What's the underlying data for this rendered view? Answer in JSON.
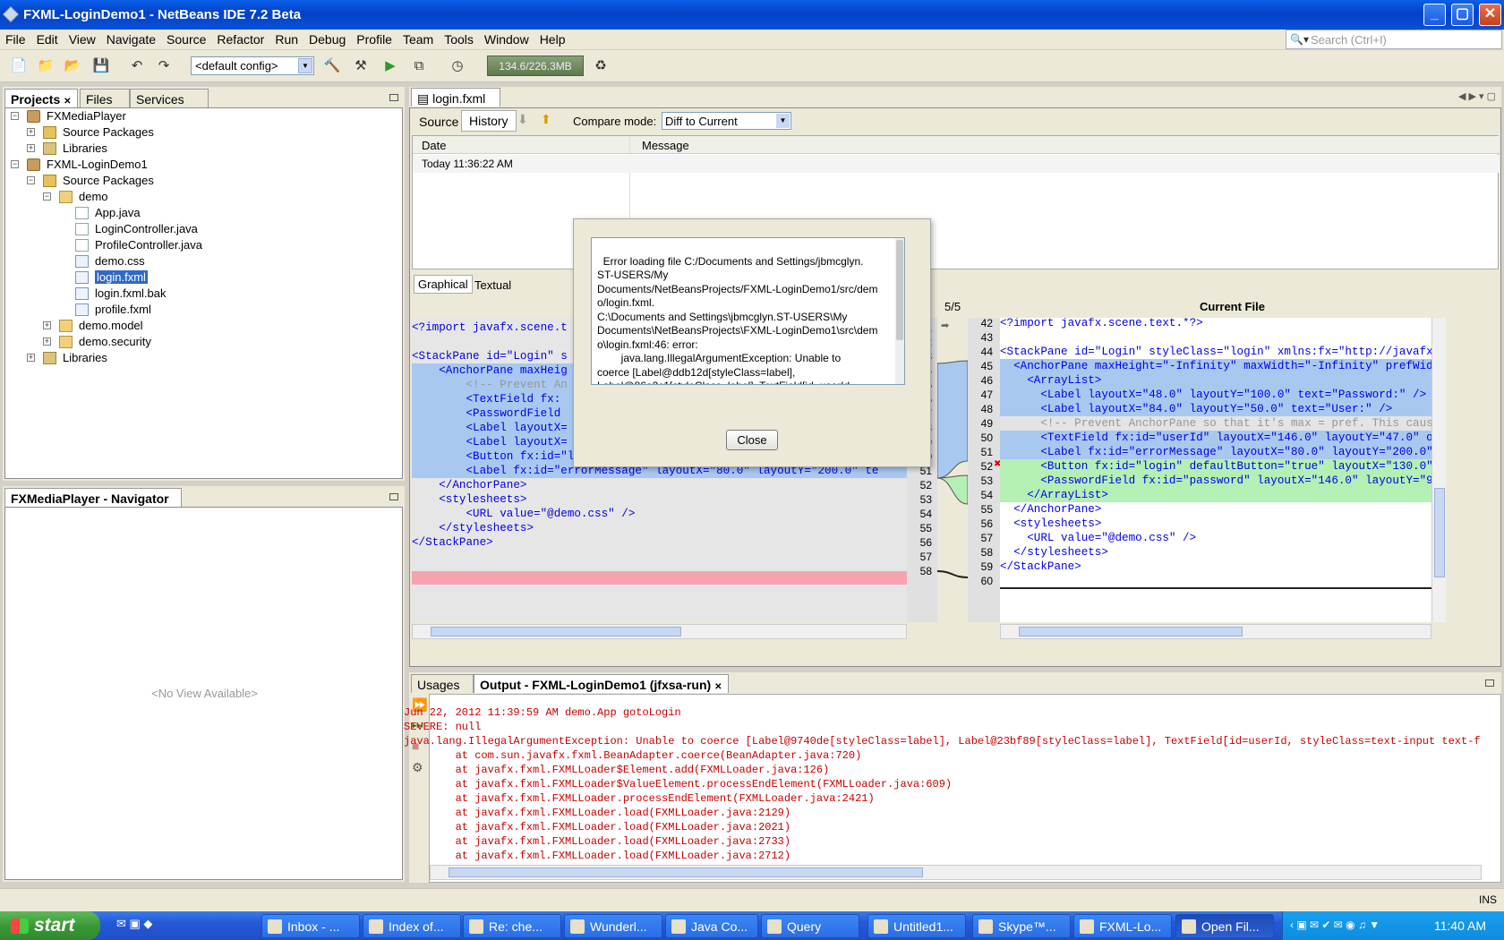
{
  "window": {
    "title": "FXML-LoginDemo1 - NetBeans IDE 7.2 Beta"
  },
  "menu": [
    "File",
    "Edit",
    "View",
    "Navigate",
    "Source",
    "Refactor",
    "Run",
    "Debug",
    "Profile",
    "Team",
    "Tools",
    "Window",
    "Help"
  ],
  "search": {
    "placeholder": "Search (Ctrl+I)"
  },
  "toolbar": {
    "config": "<default config>",
    "memory": "134.6/226.3MB"
  },
  "projects_panel": {
    "tabs": [
      "Projects",
      "Files",
      "Services"
    ],
    "tree": [
      {
        "label": "FXMediaPlayer"
      },
      {
        "label": "Source Packages"
      },
      {
        "label": "Libraries"
      },
      {
        "label": "FXML-LoginDemo1"
      },
      {
        "label": "Source Packages"
      },
      {
        "label": "demo"
      },
      {
        "label": "App.java"
      },
      {
        "label": "LoginController.java"
      },
      {
        "label": "ProfileController.java"
      },
      {
        "label": "demo.css"
      },
      {
        "label": "login.fxml"
      },
      {
        "label": "login.fxml.bak"
      },
      {
        "label": "profile.fxml"
      },
      {
        "label": "demo.model"
      },
      {
        "label": "demo.security"
      },
      {
        "label": "Libraries"
      }
    ]
  },
  "navigator": {
    "title": "FXMediaPlayer - Navigator",
    "empty": "<No View Available>"
  },
  "editor": {
    "tab": "login.fxml",
    "subtabs": [
      "Source",
      "History"
    ],
    "compare_label": "Compare mode:",
    "compare_value": "Diff to Current",
    "history_headers": [
      "Date",
      "Message"
    ],
    "history_row": "Today 11:36:22 AM",
    "diff_tabs": [
      "Graphical",
      "Textual"
    ],
    "diff_count": "5/5",
    "right_title": "Current File"
  },
  "left_code": [
    "<?import javafx.scene.t",
    "",
    "<StackPane id=\"Login\" s",
    "    <AnchorPane maxHeig",
    "        <!-- Prevent An",
    "        <TextField fx:",
    "        <PasswordField",
    "        <Label layoutX=",
    "        <Label layoutX=",
    "        <Button fx:id=\"login\" defaultButton=\"true\" layoutX=\"200.0\" la",
    "        <Label fx:id=\"errorMessage\" layoutX=\"80.0\" layoutY=\"200.0\" te",
    "    </AnchorPane>",
    "    <stylesheets>",
    "        <URL value=\"@demo.css\" />",
    "    </stylesheets>",
    "</StackPane>",
    ""
  ],
  "left_nums": [
    "1",
    "2",
    "3",
    "4",
    "5",
    "6",
    "7",
    "8",
    "9",
    "50",
    "51",
    "52",
    "53",
    "54",
    "55",
    "56",
    "57",
    "58"
  ],
  "right_code": [
    "<?import javafx.scene.text.*?>",
    "",
    "<StackPane id=\"Login\" styleClass=\"login\" xmlns:fx=\"http://javafx.",
    "  <AnchorPane maxHeight=\"-Infinity\" maxWidth=\"-Infinity\" prefWidt",
    "    <ArrayList>",
    "      <Label layoutX=\"48.0\" layoutY=\"100.0\" text=\"Password:\" />",
    "      <Label layoutX=\"84.0\" layoutY=\"50.0\" text=\"User:\" />",
    "      <!-- Prevent AnchorPane so that it's max = pref. This cause",
    "      <TextField fx:id=\"userId\" layoutX=\"146.0\" layoutY=\"47.0\" or",
    "      <Label fx:id=\"errorMessage\" layoutX=\"80.0\" layoutY=\"200.0\"",
    "      <Button fx:id=\"login\" defaultButton=\"true\" layoutX=\"130.0\"",
    "      <PasswordField fx:id=\"password\" layoutX=\"146.0\" layoutY=\"9",
    "    </ArrayList>",
    "  </AnchorPane>",
    "  <stylesheets>",
    "    <URL value=\"@demo.css\" />",
    "  </stylesheets>",
    "</StackPane>",
    ""
  ],
  "right_nums": [
    "42",
    "43",
    "44",
    "45",
    "46",
    "47",
    "48",
    "49",
    "50",
    "51",
    "52",
    "53",
    "54",
    "55",
    "56",
    "57",
    "58",
    "59",
    "60"
  ],
  "dialog": {
    "message": "Error loading file C:/Documents and Settings/jbmcglyn.\nST-USERS/My\nDocuments/NetBeansProjects/FXML-LoginDemo1/src/dem\no/login.fxml.\nC:\\Documents and Settings\\jbmcglyn.ST-USERS\\My\nDocuments\\NetBeansProjects\\FXML-LoginDemo1\\src\\dem\no\\login.fxml:46: error:\n        java.lang.IllegalArgumentException: Unable to\ncoerce [Label@ddb12d[styleClass=label],\nLabel@86a2c1[styleClass=label], TextField[id=userId,",
    "close": "Close"
  },
  "output": {
    "tabs": [
      "Usages",
      "Output - FXML-LoginDemo1 (jfxsa-run)"
    ],
    "lines": [
      "Jun 22, 2012 11:39:59 AM demo.App gotoLogin",
      "SEVERE: null",
      "java.lang.IllegalArgumentException: Unable to coerce [Label@9740de[styleClass=label], Label@23bf89[styleClass=label], TextField[id=userId, styleClass=text-input text-f:",
      "        at com.sun.javafx.fxml.BeanAdapter.coerce(BeanAdapter.java:720)",
      "        at javafx.fxml.FXMLLoader$Element.add(FXMLLoader.java:126)",
      "        at javafx.fxml.FXMLLoader$ValueElement.processEndElement(FXMLLoader.java:609)",
      "        at javafx.fxml.FXMLLoader.processEndElement(FXMLLoader.java:2421)",
      "        at javafx.fxml.FXMLLoader.load(FXMLLoader.java:2129)",
      "        at javafx.fxml.FXMLLoader.load(FXMLLoader.java:2021)",
      "        at javafx.fxml.FXMLLoader.load(FXMLLoader.java:2733)",
      "        at javafx.fxml.FXMLLoader.load(FXMLLoader.java:2712)"
    ]
  },
  "statusbar": {
    "mode": "INS"
  },
  "taskbar": {
    "start": "start",
    "tasks": [
      "Inbox - ...",
      "Index of...",
      "Re: che...",
      "Wunderl...",
      "Java Co...",
      "Query",
      "Untitled1...",
      "Skype™...",
      "FXML-Lo...",
      "Open Fil..."
    ],
    "clock": "11:40 AM"
  }
}
